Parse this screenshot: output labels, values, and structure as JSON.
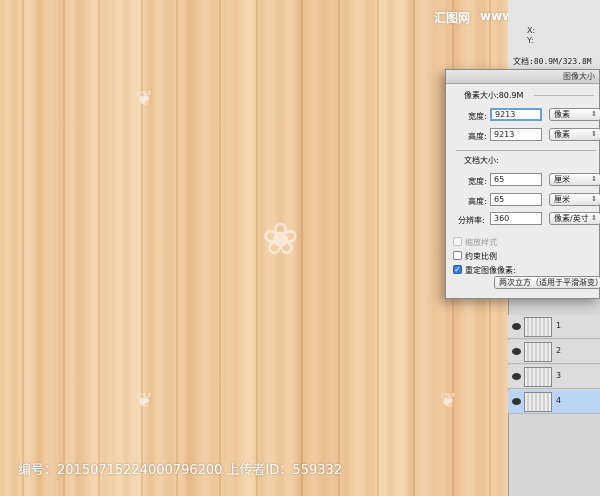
{
  "brand": {
    "logo_text": "汇图网",
    "url": "www.huitu.com"
  },
  "info_panel": {
    "x_label": "X:",
    "y_label": "Y:",
    "doc_size": "文档:80.9M/323.8M"
  },
  "dialog": {
    "title": "图像大小",
    "pixel_dimensions": {
      "heading": "像素大小:80.9M",
      "width_label": "宽度:",
      "width_value": "9213",
      "width_unit": "像素",
      "height_label": "高度:",
      "height_value": "9213",
      "height_unit": "像素"
    },
    "document_size": {
      "heading": "文档大小:",
      "width_label": "宽度:",
      "width_value": "65",
      "width_unit": "厘米",
      "height_label": "高度:",
      "height_value": "65",
      "height_unit": "厘米",
      "resolution_label": "分辨率:",
      "resolution_value": "360",
      "resolution_unit": "像素/英寸"
    },
    "options": {
      "scale_styles": "缩放样式",
      "constrain_proportions": "约束比例",
      "resample_image": "重定图像像素:",
      "resample_method": "两次立方（适用于平滑渐变）"
    }
  },
  "layers": [
    {
      "name": "1",
      "selected": false
    },
    {
      "name": "2",
      "selected": false
    },
    {
      "name": "3",
      "selected": false
    },
    {
      "name": "4",
      "selected": true
    }
  ],
  "caption": {
    "text": "编号：20150715224000796200 上传者ID：559332"
  },
  "colors": {
    "accent": "#3e7bd6",
    "wood": "#eec396",
    "selected_layer": "#bcd4f4"
  }
}
